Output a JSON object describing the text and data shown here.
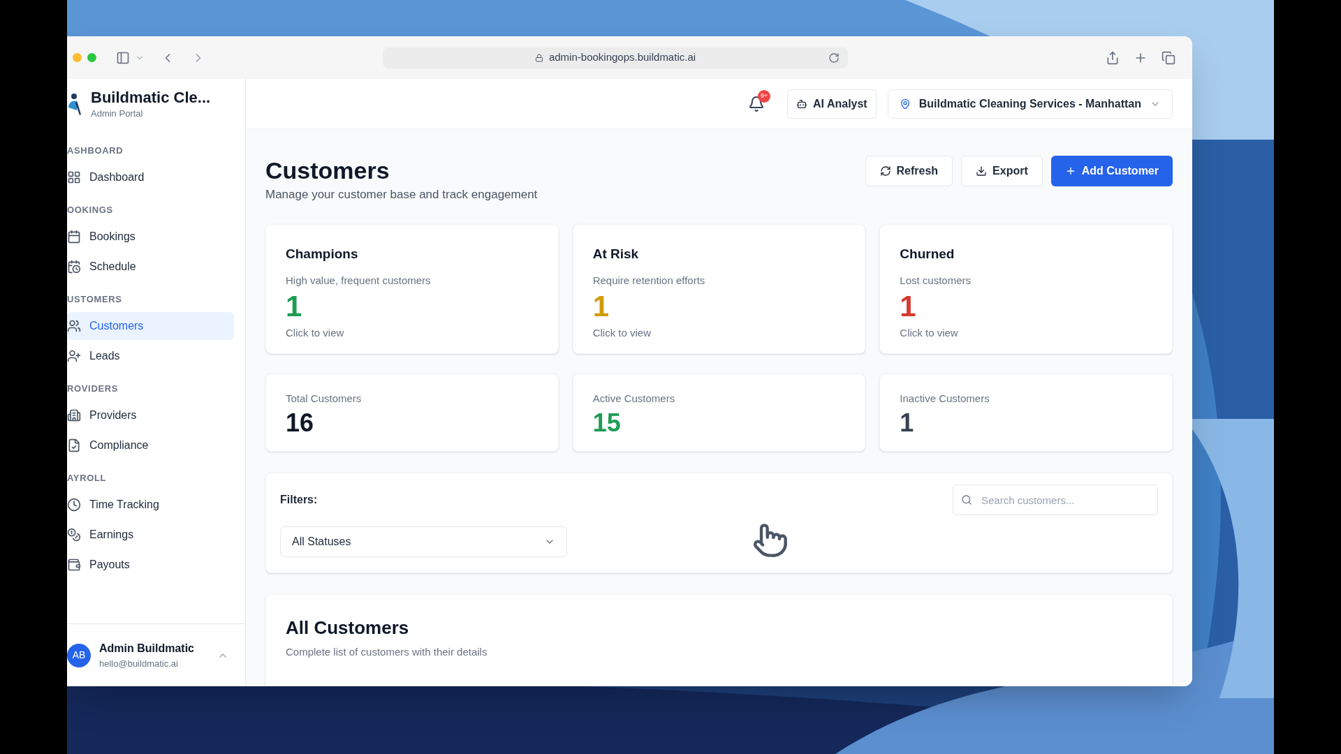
{
  "browser": {
    "url": "admin-bookingops.buildmatic.ai"
  },
  "sidebar": {
    "brand": "Buildmatic Cle...",
    "subtitle": "Admin Portal",
    "sections": [
      {
        "heading": "ASHBOARD",
        "items": [
          {
            "label": "Dashboard",
            "selected": false
          }
        ]
      },
      {
        "heading": "OOKINGS",
        "items": [
          {
            "label": "Bookings",
            "selected": false
          },
          {
            "label": "Schedule",
            "selected": false
          }
        ]
      },
      {
        "heading": "USTOMERS",
        "items": [
          {
            "label": "Customers",
            "selected": true
          },
          {
            "label": "Leads",
            "selected": false
          }
        ]
      },
      {
        "heading": "ROVIDERS",
        "items": [
          {
            "label": "Providers",
            "selected": false
          },
          {
            "label": "Compliance",
            "selected": false
          }
        ]
      },
      {
        "heading": "AYROLL",
        "items": [
          {
            "label": "Time Tracking",
            "selected": false
          },
          {
            "label": "Earnings",
            "selected": false
          },
          {
            "label": "Payouts",
            "selected": false
          }
        ]
      }
    ],
    "user": {
      "initials": "AB",
      "name": "Admin Buildmatic",
      "email": "hello@buildmatic.ai"
    }
  },
  "header": {
    "notification_badge": "9+",
    "ai_button": "AI Analyst",
    "location": "Buildmatic Cleaning Services - Manhattan"
  },
  "page": {
    "title": "Customers",
    "subtitle": "Manage your customer base and track engagement",
    "buttons": [
      {
        "label": "Refresh",
        "kind": "refresh"
      },
      {
        "label": "Export",
        "kind": "export"
      },
      {
        "label": "Add Customer",
        "kind": "primary"
      }
    ]
  },
  "segments": [
    {
      "title": "Champions",
      "description": "High value, frequent customers",
      "count": "1",
      "color": "#1f9d55",
      "link": "Click to view"
    },
    {
      "title": "At Risk",
      "description": "Require retention efforts",
      "count": "1",
      "color": "#d19a0a",
      "link": "Click to view"
    },
    {
      "title": "Churned",
      "description": "Lost customers",
      "count": "1",
      "color": "#d63a2f",
      "link": "Click to view"
    }
  ],
  "stats": [
    {
      "label": "Total Customers",
      "value": "16",
      "color": "#111827"
    },
    {
      "label": "Active Customers",
      "value": "15",
      "color": "#1f9d55"
    },
    {
      "label": "Inactive Customers",
      "value": "1",
      "color": "#374151"
    }
  ],
  "filters": {
    "label": "Filters:",
    "search_placeholder": "Search customers...",
    "status": "All Statuses"
  },
  "table": {
    "title": "All Customers",
    "subtitle": "Complete list of customers with their details"
  }
}
